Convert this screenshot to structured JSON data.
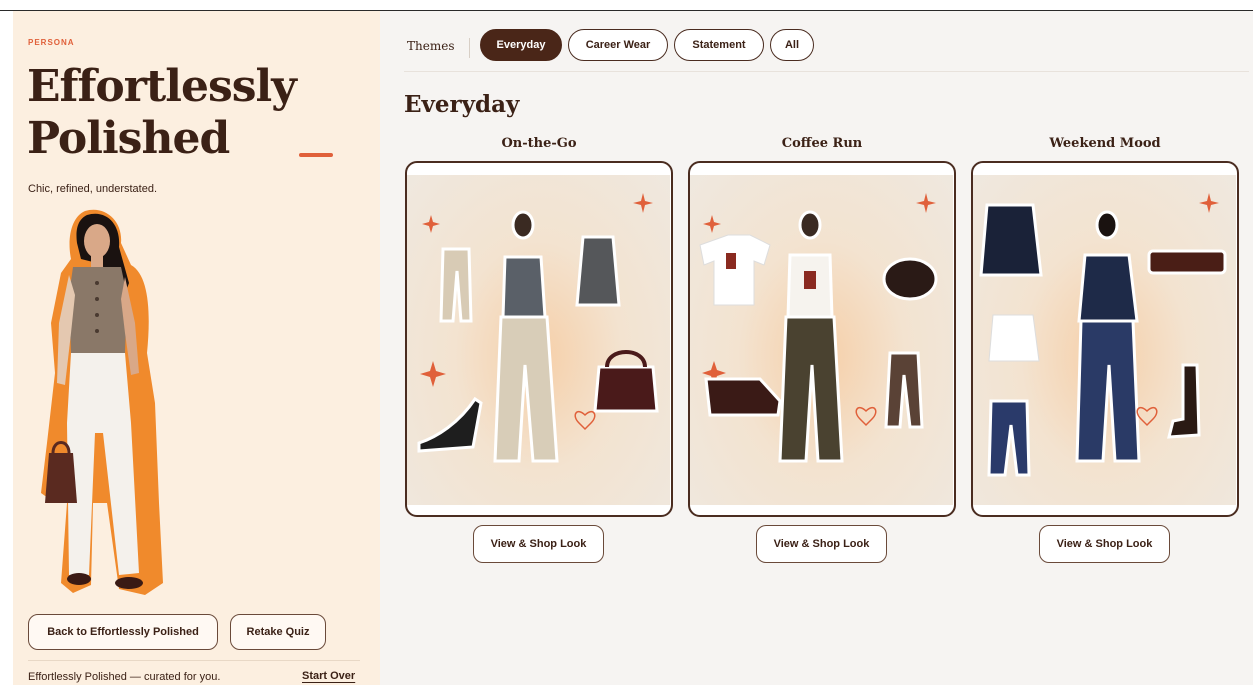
{
  "persona": {
    "label": "PERSONA",
    "title": "Effortlessly Polished",
    "subtitle": "Chic, refined, understated.",
    "back_button": "Back to Effortlessly Polished",
    "retake_button": "Retake Quiz",
    "footer_text": "Effortlessly Polished — curated for you.",
    "start_over": "Start Over"
  },
  "themes": {
    "label": "Themes",
    "tabs": [
      {
        "label": "Everyday",
        "active": true
      },
      {
        "label": "Career Wear",
        "active": false
      },
      {
        "label": "Statement",
        "active": false
      },
      {
        "label": "All",
        "active": false
      }
    ]
  },
  "section": {
    "title": "Everyday",
    "looks": [
      {
        "title": "On-the-Go",
        "button": "View & Shop Look"
      },
      {
        "title": "Coffee Run",
        "button": "View & Shop Look"
      },
      {
        "title": "Weekend Mood",
        "button": "View & Shop Look"
      }
    ]
  },
  "colors": {
    "accent": "#e0603a",
    "brown_dark": "#4a2618",
    "left_bg": "#fcefe0",
    "right_bg": "#f6f4f2"
  },
  "icons": [
    "sparkle-icon",
    "heart-icon"
  ]
}
